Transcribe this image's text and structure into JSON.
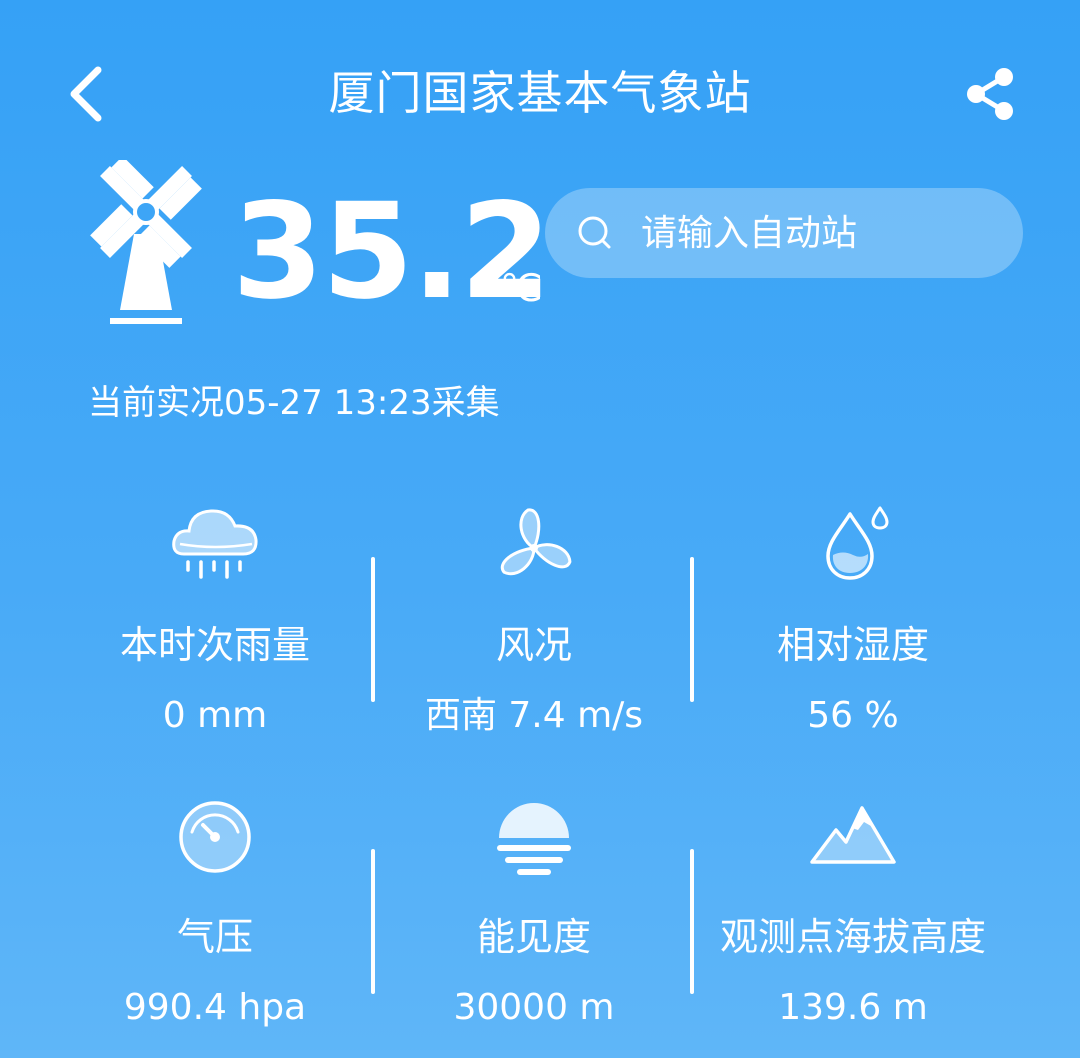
{
  "header": {
    "title": "厦门国家基本气象站",
    "back_icon": "chevron-left-icon",
    "share_icon": "share-icon"
  },
  "current": {
    "temperature": "35.2",
    "unit": "℃",
    "observed": "当前实况05-27 13:23采集",
    "weather_icon": "windmill-icon"
  },
  "search": {
    "placeholder": "请输入自动站",
    "value": ""
  },
  "metrics": [
    {
      "label": "本时次雨量",
      "value": "0 mm",
      "icon": "rain-cloud-icon"
    },
    {
      "label": "风况",
      "value": "西南 7.4 m/s",
      "icon": "fan-icon"
    },
    {
      "label": "相对湿度",
      "value": "56 %",
      "icon": "water-drop-icon"
    },
    {
      "label": "气压",
      "value": "990.4 hpa",
      "icon": "gauge-icon"
    },
    {
      "label": "能见度",
      "value": "30000 m",
      "icon": "visibility-sun-icon"
    },
    {
      "label": "观测点海拔高度",
      "value": "139.6 m",
      "icon": "mountain-icon"
    }
  ],
  "colors": {
    "background_top": "#35a1f6",
    "background_bottom": "#5fb6f8",
    "text": "#ffffff"
  }
}
